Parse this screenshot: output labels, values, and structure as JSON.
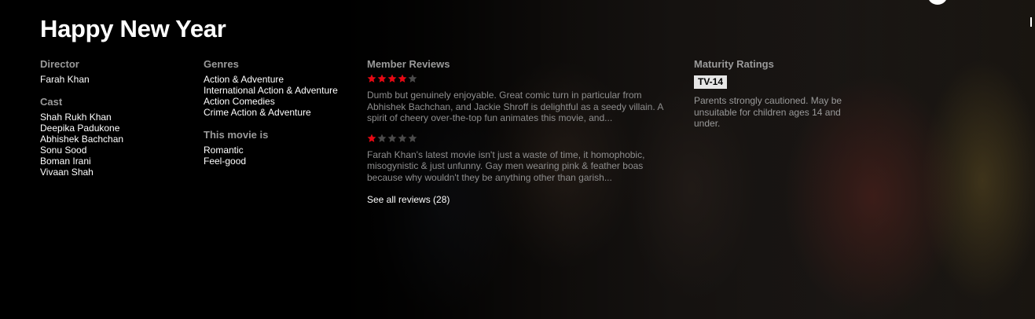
{
  "title": "Happy New Year",
  "director": {
    "label": "Director",
    "names": [
      "Farah Khan"
    ]
  },
  "cast": {
    "label": "Cast",
    "names": [
      "Shah Rukh Khan",
      "Deepika Padukone",
      "Abhishek Bachchan",
      "Sonu Sood",
      "Boman Irani",
      "Vivaan Shah"
    ]
  },
  "genres": {
    "label": "Genres",
    "items": [
      "Action & Adventure",
      "International Action & Adventure",
      "Action Comedies",
      "Crime Action & Adventure"
    ]
  },
  "this_movie_is": {
    "label": "This movie is",
    "items": [
      "Romantic",
      "Feel-good"
    ]
  },
  "reviews": {
    "label": "Member Reviews",
    "items": [
      {
        "stars": 4,
        "max_stars": 5,
        "text": "Dumb but genuinely enjoyable. Great comic turn in particular from Abhishek Bachchan, and Jackie Shroff is delightful as a seedy villain. A spirit of cheery over-the-top fun animates this movie, and..."
      },
      {
        "stars": 1,
        "max_stars": 5,
        "text": "Farah Khan's latest movie isn't just a waste of time, it homophobic, misogynistic & just unfunny. Gay men wearing pink & feather boas because why wouldn't they be anything other than garish..."
      }
    ],
    "see_all_label": "See all reviews (28)"
  },
  "maturity": {
    "label": "Maturity Ratings",
    "rating": "TV-14",
    "description": "Parents strongly cautioned. May be unsuitable for children ages 14 and under."
  },
  "colors": {
    "star_filled": "#e50914",
    "star_empty": "#4a4a4a",
    "label": "#9a9a9a",
    "badge_bg": "#e6e6e6"
  },
  "icons": {
    "star": "star-icon"
  }
}
